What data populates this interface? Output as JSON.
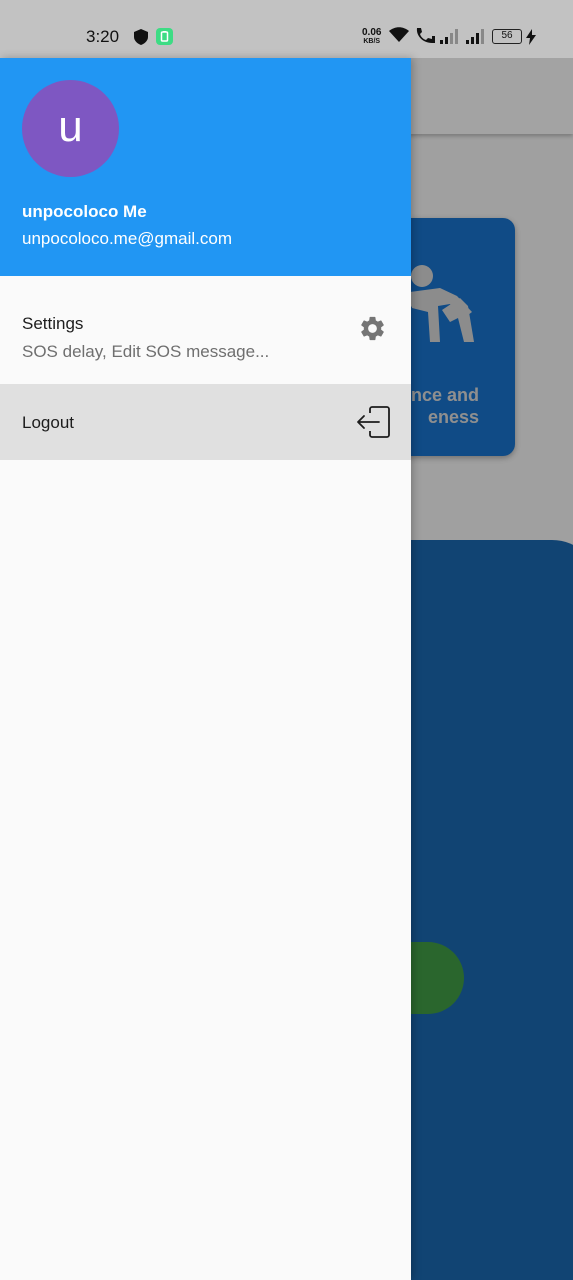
{
  "status_bar": {
    "time": "3:20",
    "net_speed_value": "0.06",
    "net_speed_unit": "KB/S",
    "battery_level": "56",
    "icons": [
      "shield-icon",
      "battery-saver-icon",
      "wifi-icon",
      "call-icon",
      "signal-icon",
      "signal-icon",
      "charging-icon"
    ]
  },
  "background": {
    "card_label_line1": "ence and",
    "card_label_line2": "eness",
    "card_icon": "self-defense-icon",
    "accent_color": "#1976d2"
  },
  "drawer": {
    "avatar_initial": "u",
    "user_name": "unpocoloco Me",
    "user_email": "unpocoloco.me@gmail.com",
    "header_color": "#2196f3",
    "avatar_color": "#7e57c2",
    "items": [
      {
        "title": "Settings",
        "subtitle": "SOS delay, Edit SOS message...",
        "icon": "gear-icon"
      },
      {
        "title": "Logout",
        "icon": "logout-icon"
      }
    ]
  }
}
